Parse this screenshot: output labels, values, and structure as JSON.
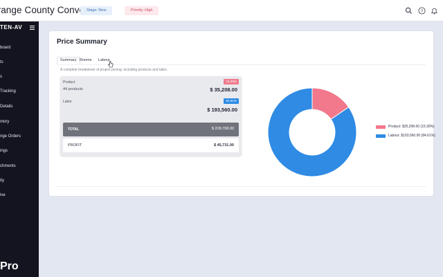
{
  "header": {
    "title": "Orange County Conve...",
    "stage_badge": "Stage: New",
    "priority_badge": "Priority: High",
    "icons": [
      "search-icon",
      "help-icon",
      "bell-icon"
    ]
  },
  "sidebar": {
    "brand": "TEN-AV",
    "items": [
      {
        "label": "board"
      },
      {
        "label": "ts"
      },
      {
        "label": "s"
      },
      {
        "label": "Tracking"
      },
      {
        "label": "Details"
      },
      {
        "label": "ntory"
      },
      {
        "label": "nge Orders"
      },
      {
        "label": "ings"
      },
      {
        "label": "chments"
      },
      {
        "label": "ity"
      },
      {
        "label": "ive"
      }
    ],
    "footer": "Pro"
  },
  "price_summary": {
    "title": "Price Summary",
    "tabs": [
      "Summary",
      "Rooms",
      "Labour"
    ],
    "active_tab": "Summary",
    "description": "A complete breakdown of project pricing, including products and labor.",
    "product": {
      "label": "Product",
      "count": "44 products",
      "amount": "$ 35,208.00",
      "percent": "15.39%"
    },
    "labor": {
      "label": "Labor",
      "amount": "$ 193,560.00",
      "percent": "84.61%"
    },
    "total": {
      "label": "TOTAL",
      "amount": "$ 228,768.00"
    },
    "profit": {
      "label": "PROFIT",
      "amount": "$ 45,731.00"
    }
  },
  "chart_data": {
    "type": "pie",
    "categories": [
      "Product",
      "Labour"
    ],
    "values": [
      35208.0,
      193560.0
    ],
    "percentages": [
      15.39,
      84.61
    ],
    "legend": [
      "Product: $35,208.00 (15.39%)",
      "Labour: $193,560.00 (84.61%)"
    ],
    "colors": [
      "#f2788b",
      "#2f8be4"
    ],
    "legend_position": "right"
  }
}
